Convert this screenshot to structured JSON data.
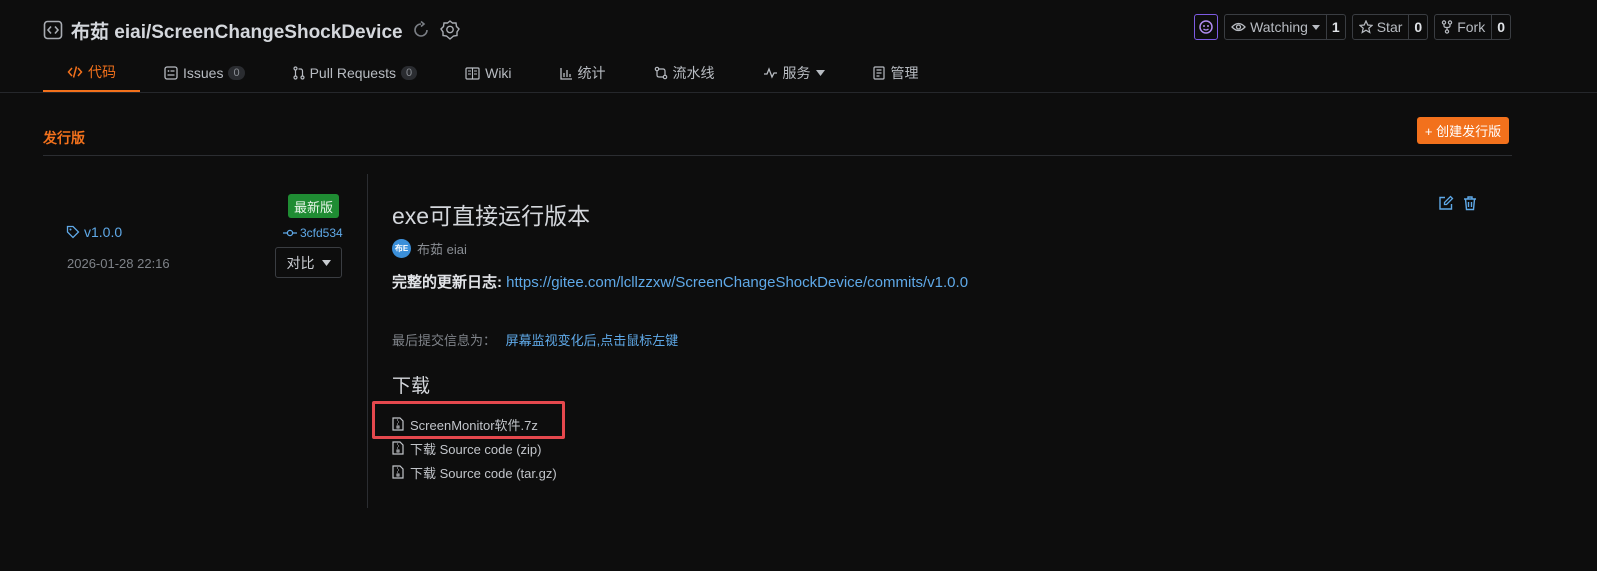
{
  "repo": {
    "title": "布茹 eiai/ScreenChangeShockDevice",
    "watch_label": "Watching",
    "watch_count": "1",
    "star_label": "Star",
    "star_count": "0",
    "fork_label": "Fork",
    "fork_count": "0"
  },
  "tabs": [
    {
      "label": "代码",
      "icon": "code-icon"
    },
    {
      "label": "Issues",
      "badge": "0",
      "icon": "issues-icon"
    },
    {
      "label": "Pull Requests",
      "badge": "0",
      "icon": "pull-request-icon"
    },
    {
      "label": "Wiki",
      "icon": "wiki-icon"
    },
    {
      "label": "统计",
      "icon": "stats-icon"
    },
    {
      "label": "流水线",
      "icon": "pipeline-icon"
    },
    {
      "label": "服务",
      "icon": "pulse-icon"
    },
    {
      "label": "管理",
      "icon": "manage-icon"
    }
  ],
  "section": {
    "title": "发行版",
    "create_label": "+ 创建发行版"
  },
  "release": {
    "latest_badge": "最新版",
    "tag": "v1.0.0",
    "commit": "3cfd534",
    "date": "2026-01-28 22:16",
    "compare_label": "对比",
    "title": "exe可直接运行版本",
    "avatar_text": "布E",
    "author": "布茹 eiai",
    "changelog_label": "完整的更新日志:",
    "changelog_url": "https://gitee.com/lcllzzxw/ScreenChangeShockDevice/commits/v1.0.0",
    "last_commit_label": "最后提交信息为：",
    "last_commit_msg": "屏幕监视变化后,点击鼠标左键"
  },
  "downloads": {
    "title": "下载",
    "files": [
      "ScreenMonitor软件.7z",
      "下载 Source code (zip)",
      "下载 Source code (tar.gz)"
    ]
  },
  "colors": {
    "accent": "#f2711c",
    "link": "#5fa9e8",
    "highlight": "#e5484d",
    "latest": "#1f8c33"
  }
}
